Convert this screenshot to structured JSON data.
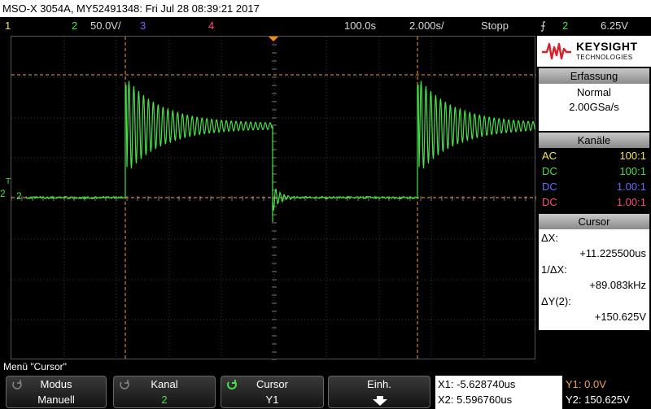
{
  "title_bar": "MSO-X 3054A, MY52491348: Fri Jul 28 08:39:21 2017",
  "status": {
    "ch1": "1",
    "ch2": "2",
    "ch2_scale": "50.0V/",
    "ch3": "3",
    "ch4": "4",
    "hpos": "100.0s",
    "time_div": "2.000s/",
    "run_state": "Stopp",
    "trig_ch": "2",
    "trig_level": "6.25V"
  },
  "screen": {
    "ch2_marker": "2",
    "trig_marker": "T"
  },
  "logo": {
    "brand": "KEYSIGHT",
    "sub": "TECHNOLOGIES"
  },
  "acquisition": {
    "header": "Erfassung",
    "mode": "Normal",
    "rate": "2.00GSa/s"
  },
  "channels": {
    "header": "Kanäle",
    "rows": [
      {
        "coupling": "AC",
        "probe": "100:1",
        "color": "#f5e84a"
      },
      {
        "coupling": "DC",
        "probe": "100:1",
        "color": "#48e048"
      },
      {
        "coupling": "DC",
        "probe": "1.00:1",
        "color": "#6a6aff"
      },
      {
        "coupling": "DC",
        "probe": "1.00:1",
        "color": "#ff4a7c"
      }
    ]
  },
  "cursor_panel": {
    "header": "Cursor",
    "dx_label": "ΔX:",
    "dx_value": "+11.225500us",
    "inv_dx_label": "1/ΔX:",
    "inv_dx_value": "+89.083kHz",
    "dy_label": "ΔY(2):",
    "dy_value": "+150.625V"
  },
  "menu_title": "Menü \"Cursor\"",
  "softkeys": [
    {
      "title": "Modus",
      "value": "Manuell"
    },
    {
      "title": "Kanal",
      "value": "2"
    },
    {
      "title": "Cursor",
      "value": "Y1"
    },
    {
      "title": "Einh.",
      "value": ""
    }
  ],
  "cursor_info": {
    "x1": "X1: -5.628740us",
    "x2": "X2: 5.596760us",
    "y1": "Y1: 0.0V",
    "y2": "Y2: 150.625V"
  },
  "colors": {
    "ch1": "#f5e84a",
    "ch2": "#48e048",
    "ch3": "#6a6aff",
    "ch4": "#ff4a7c",
    "cursor": "#f0a050",
    "trigger": "#ff8a00"
  }
}
